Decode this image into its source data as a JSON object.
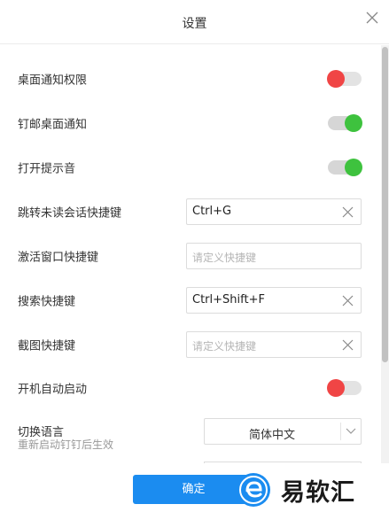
{
  "dialog": {
    "title": "设置"
  },
  "settings": {
    "desktop_notify_permission": {
      "label": "桌面通知权限",
      "enabled": false
    },
    "pin_desktop_notify": {
      "label": "钉邮桌面通知",
      "enabled": true
    },
    "sound": {
      "label": "打开提示音",
      "enabled": true
    },
    "unread_hotkey": {
      "label": "跳转未读会话快捷键",
      "value": "Ctrl+G"
    },
    "activate_hotkey": {
      "label": "激活窗口快捷键",
      "placeholder": "请定义快捷键"
    },
    "search_hotkey": {
      "label": "搜索快捷键",
      "value": "Ctrl+Shift+F"
    },
    "screenshot_hotkey": {
      "label": "截图快捷键",
      "placeholder": "请定义快捷键"
    },
    "autostart": {
      "label": "开机自动启动",
      "enabled": false
    },
    "language": {
      "label": "切换语言",
      "hint": "重新启动钉钉后生效",
      "selected": "简体中文"
    }
  },
  "footer": {
    "confirm_label": "确定"
  },
  "watermark": {
    "text": "易软汇"
  },
  "colors": {
    "primary": "#1b8cf0",
    "toggle_on": "#3ec23e",
    "toggle_off": "#f04545"
  }
}
